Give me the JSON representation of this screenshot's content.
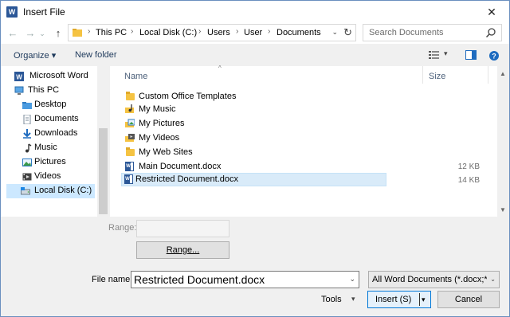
{
  "title": "Insert File",
  "app_icon": "word-icon",
  "close_glyph": "✕",
  "nav": {
    "back_glyph": "←",
    "forward_glyph": "→",
    "recent_glyph": "⌄",
    "up_glyph": "↑"
  },
  "address": {
    "crumbs": [
      "This PC",
      "Local Disk (C:)",
      "Users",
      "User",
      "Documents"
    ],
    "separator": "›",
    "dropdown_glyph": "⌄",
    "refresh_glyph": "↻"
  },
  "search": {
    "placeholder": "Search Documents"
  },
  "commands": {
    "organize": "Organize ▾",
    "new_folder": "New folder",
    "view_menu_glyph": "▾"
  },
  "nav_pane": {
    "items": [
      {
        "label": "Microsoft Word",
        "icon": "word-icon"
      },
      {
        "label": "This PC",
        "icon": "computer-icon"
      },
      {
        "label": "Desktop",
        "icon": "folder-icon"
      },
      {
        "label": "Documents",
        "icon": "documents-icon"
      },
      {
        "label": "Downloads",
        "icon": "downloads-icon"
      },
      {
        "label": "Music",
        "icon": "music-icon"
      },
      {
        "label": "Pictures",
        "icon": "pictures-icon"
      },
      {
        "label": "Videos",
        "icon": "videos-icon"
      },
      {
        "label": "Local Disk (C:)",
        "icon": "drive-icon"
      }
    ],
    "selected_index": 8
  },
  "file_list": {
    "columns": {
      "name": "Name",
      "size": "Size"
    },
    "files": [
      {
        "name": "Custom Office Templates",
        "size": "",
        "icon": "folder-icon"
      },
      {
        "name": "My Music",
        "size": "",
        "icon": "music-folder-icon"
      },
      {
        "name": "My Pictures",
        "size": "",
        "icon": "pictures-folder-icon"
      },
      {
        "name": "My Videos",
        "size": "",
        "icon": "videos-folder-icon"
      },
      {
        "name": "My Web Sites",
        "size": "",
        "icon": "folder-icon"
      },
      {
        "name": "Main Document.docx",
        "size": "12 KB",
        "icon": "word-doc-icon"
      },
      {
        "name": "Restricted Document.docx",
        "size": "14 KB",
        "icon": "word-doc-icon"
      }
    ],
    "selected_index": 6
  },
  "range": {
    "label": "Range:",
    "button_label": "Range..."
  },
  "file_name": {
    "label": "File name:",
    "value": "Restricted Document.docx",
    "dropdown_glyph": "⌄"
  },
  "file_type": {
    "value": "All Word Documents (*.docx;*.d",
    "dropdown_glyph": "⌄"
  },
  "tools": {
    "label": "Tools",
    "dropdown_glyph": "▾"
  },
  "insert": {
    "label": "Insert (S)",
    "split_glyph": "▾"
  },
  "cancel": {
    "label": "Cancel"
  }
}
